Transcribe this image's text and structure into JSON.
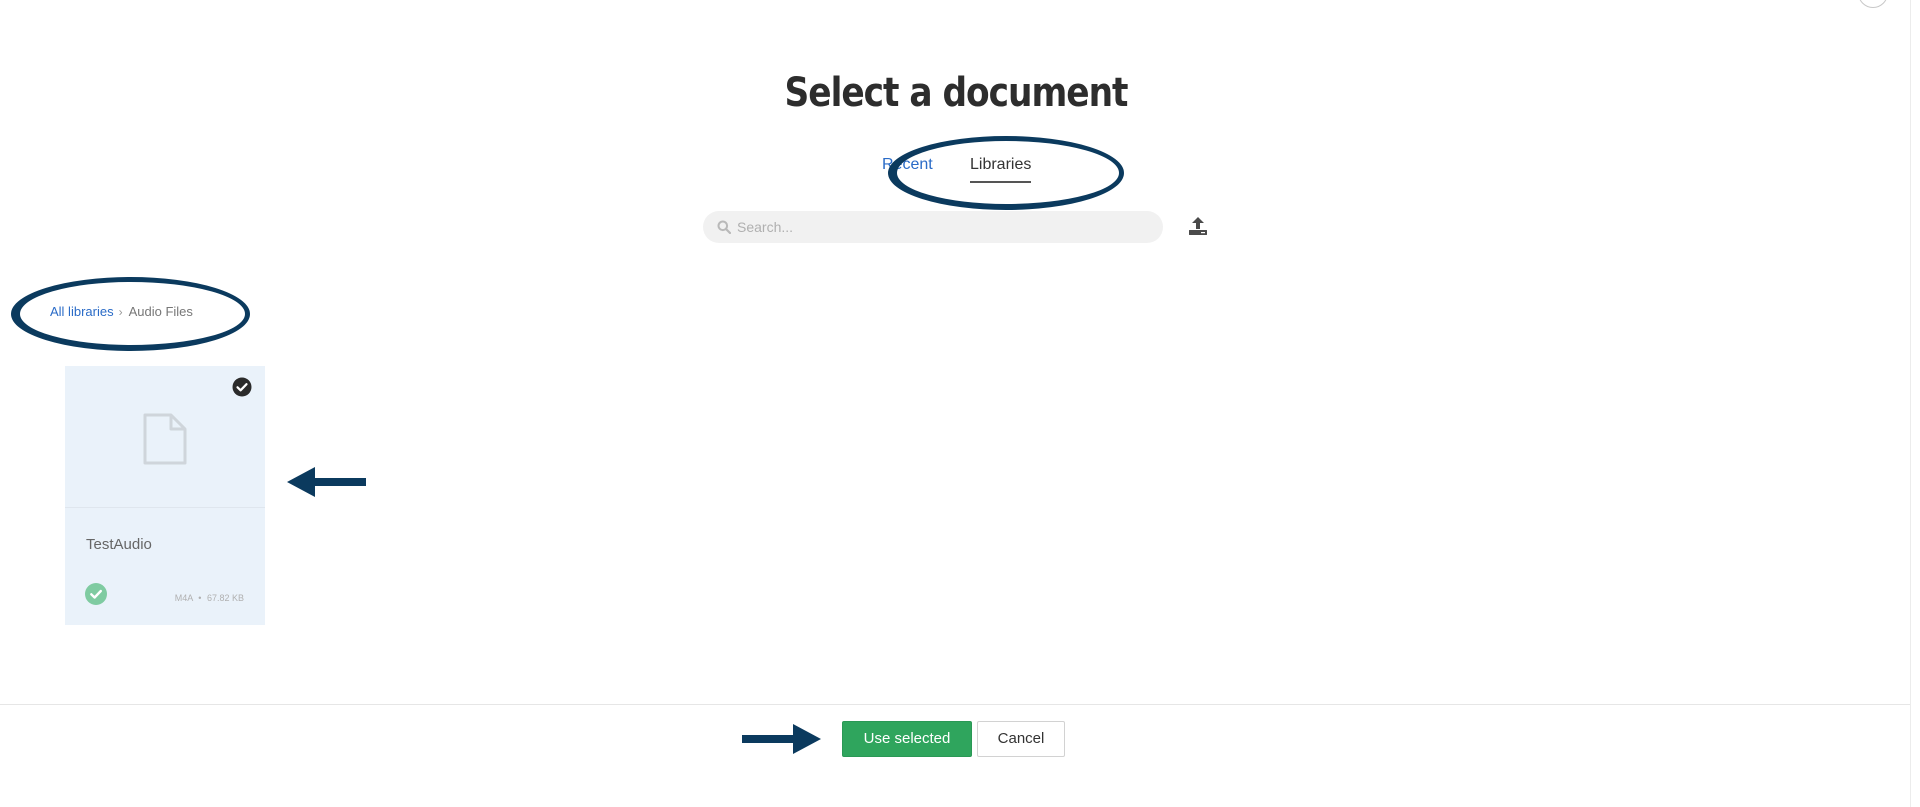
{
  "dialog": {
    "title": "Select a document"
  },
  "tabs": [
    {
      "label": "Recent",
      "active": false
    },
    {
      "label": "Libraries",
      "active": true
    }
  ],
  "search": {
    "placeholder": "Search...",
    "value": ""
  },
  "breadcrumb": {
    "root": "All libraries",
    "separator": "›",
    "current": "Audio Files"
  },
  "files": [
    {
      "name": "TestAudio",
      "type": "M4A",
      "separator": "•",
      "size": "67.82 KB",
      "selected": true
    }
  ],
  "footer": {
    "use_selected_label": "Use selected",
    "cancel_label": "Cancel"
  },
  "colors": {
    "accent_link": "#2a6bc7",
    "primary_button": "#2fa55d",
    "annotation": "#0b3a5e",
    "card_background": "#eaf2fa",
    "status_ok": "#7fcba1"
  },
  "icons": {
    "search": "search-icon",
    "upload": "upload-icon",
    "file": "file-icon",
    "selected": "check-circle-icon",
    "status": "check-circle-icon"
  }
}
